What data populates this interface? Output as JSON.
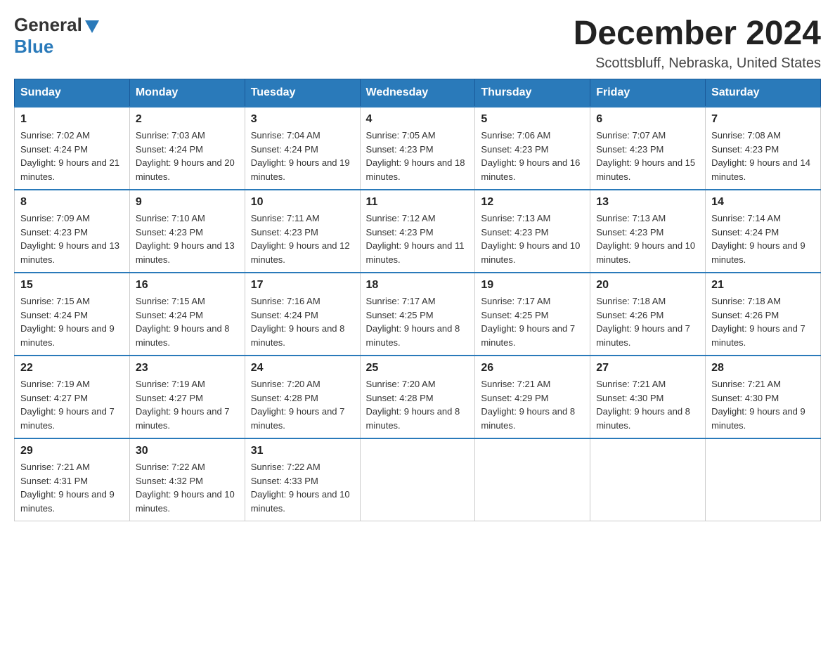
{
  "logo": {
    "general": "General",
    "blue": "Blue"
  },
  "header": {
    "month": "December 2024",
    "location": "Scottsbluff, Nebraska, United States"
  },
  "weekdays": [
    "Sunday",
    "Monday",
    "Tuesday",
    "Wednesday",
    "Thursday",
    "Friday",
    "Saturday"
  ],
  "weeks": [
    [
      {
        "day": "1",
        "sunrise": "7:02 AM",
        "sunset": "4:24 PM",
        "daylight": "9 hours and 21 minutes."
      },
      {
        "day": "2",
        "sunrise": "7:03 AM",
        "sunset": "4:24 PM",
        "daylight": "9 hours and 20 minutes."
      },
      {
        "day": "3",
        "sunrise": "7:04 AM",
        "sunset": "4:24 PM",
        "daylight": "9 hours and 19 minutes."
      },
      {
        "day": "4",
        "sunrise": "7:05 AM",
        "sunset": "4:23 PM",
        "daylight": "9 hours and 18 minutes."
      },
      {
        "day": "5",
        "sunrise": "7:06 AM",
        "sunset": "4:23 PM",
        "daylight": "9 hours and 16 minutes."
      },
      {
        "day": "6",
        "sunrise": "7:07 AM",
        "sunset": "4:23 PM",
        "daylight": "9 hours and 15 minutes."
      },
      {
        "day": "7",
        "sunrise": "7:08 AM",
        "sunset": "4:23 PM",
        "daylight": "9 hours and 14 minutes."
      }
    ],
    [
      {
        "day": "8",
        "sunrise": "7:09 AM",
        "sunset": "4:23 PM",
        "daylight": "9 hours and 13 minutes."
      },
      {
        "day": "9",
        "sunrise": "7:10 AM",
        "sunset": "4:23 PM",
        "daylight": "9 hours and 13 minutes."
      },
      {
        "day": "10",
        "sunrise": "7:11 AM",
        "sunset": "4:23 PM",
        "daylight": "9 hours and 12 minutes."
      },
      {
        "day": "11",
        "sunrise": "7:12 AM",
        "sunset": "4:23 PM",
        "daylight": "9 hours and 11 minutes."
      },
      {
        "day": "12",
        "sunrise": "7:13 AM",
        "sunset": "4:23 PM",
        "daylight": "9 hours and 10 minutes."
      },
      {
        "day": "13",
        "sunrise": "7:13 AM",
        "sunset": "4:23 PM",
        "daylight": "9 hours and 10 minutes."
      },
      {
        "day": "14",
        "sunrise": "7:14 AM",
        "sunset": "4:24 PM",
        "daylight": "9 hours and 9 minutes."
      }
    ],
    [
      {
        "day": "15",
        "sunrise": "7:15 AM",
        "sunset": "4:24 PM",
        "daylight": "9 hours and 9 minutes."
      },
      {
        "day": "16",
        "sunrise": "7:15 AM",
        "sunset": "4:24 PM",
        "daylight": "9 hours and 8 minutes."
      },
      {
        "day": "17",
        "sunrise": "7:16 AM",
        "sunset": "4:24 PM",
        "daylight": "9 hours and 8 minutes."
      },
      {
        "day": "18",
        "sunrise": "7:17 AM",
        "sunset": "4:25 PM",
        "daylight": "9 hours and 8 minutes."
      },
      {
        "day": "19",
        "sunrise": "7:17 AM",
        "sunset": "4:25 PM",
        "daylight": "9 hours and 7 minutes."
      },
      {
        "day": "20",
        "sunrise": "7:18 AM",
        "sunset": "4:26 PM",
        "daylight": "9 hours and 7 minutes."
      },
      {
        "day": "21",
        "sunrise": "7:18 AM",
        "sunset": "4:26 PM",
        "daylight": "9 hours and 7 minutes."
      }
    ],
    [
      {
        "day": "22",
        "sunrise": "7:19 AM",
        "sunset": "4:27 PM",
        "daylight": "9 hours and 7 minutes."
      },
      {
        "day": "23",
        "sunrise": "7:19 AM",
        "sunset": "4:27 PM",
        "daylight": "9 hours and 7 minutes."
      },
      {
        "day": "24",
        "sunrise": "7:20 AM",
        "sunset": "4:28 PM",
        "daylight": "9 hours and 7 minutes."
      },
      {
        "day": "25",
        "sunrise": "7:20 AM",
        "sunset": "4:28 PM",
        "daylight": "9 hours and 8 minutes."
      },
      {
        "day": "26",
        "sunrise": "7:21 AM",
        "sunset": "4:29 PM",
        "daylight": "9 hours and 8 minutes."
      },
      {
        "day": "27",
        "sunrise": "7:21 AM",
        "sunset": "4:30 PM",
        "daylight": "9 hours and 8 minutes."
      },
      {
        "day": "28",
        "sunrise": "7:21 AM",
        "sunset": "4:30 PM",
        "daylight": "9 hours and 9 minutes."
      }
    ],
    [
      {
        "day": "29",
        "sunrise": "7:21 AM",
        "sunset": "4:31 PM",
        "daylight": "9 hours and 9 minutes."
      },
      {
        "day": "30",
        "sunrise": "7:22 AM",
        "sunset": "4:32 PM",
        "daylight": "9 hours and 10 minutes."
      },
      {
        "day": "31",
        "sunrise": "7:22 AM",
        "sunset": "4:33 PM",
        "daylight": "9 hours and 10 minutes."
      },
      null,
      null,
      null,
      null
    ]
  ],
  "labels": {
    "sunrise": "Sunrise:",
    "sunset": "Sunset:",
    "daylight": "Daylight:"
  }
}
